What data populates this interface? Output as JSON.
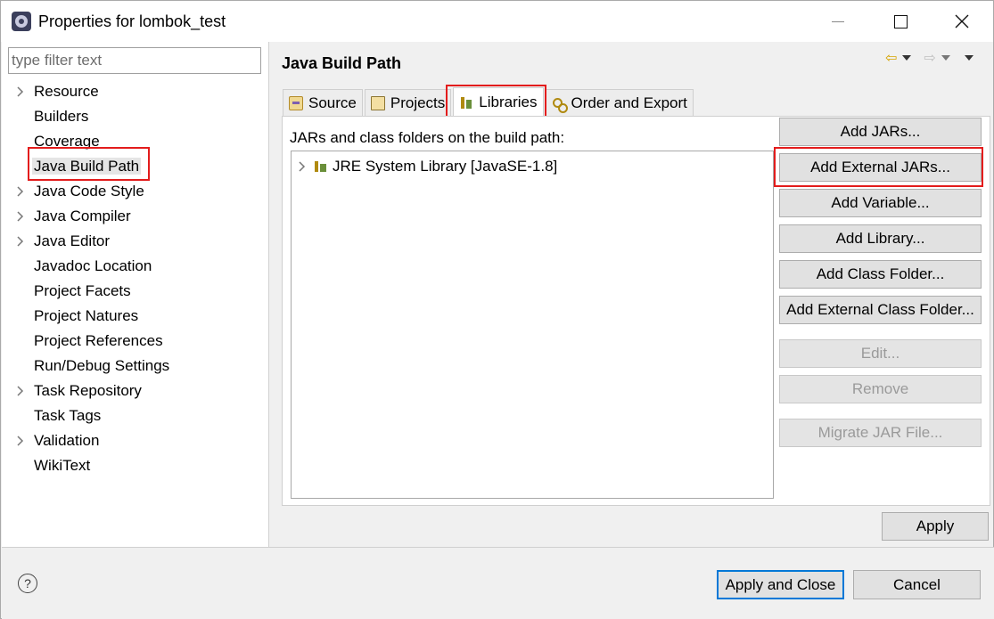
{
  "window": {
    "title": "Properties for lombok_test"
  },
  "filter": {
    "placeholder": "type filter text"
  },
  "tree": {
    "items": [
      {
        "label": "Resource",
        "expandable": true
      },
      {
        "label": "Builders",
        "expandable": false
      },
      {
        "label": "Coverage",
        "expandable": false
      },
      {
        "label": "Java Build Path",
        "expandable": false,
        "selected": true
      },
      {
        "label": "Java Code Style",
        "expandable": true
      },
      {
        "label": "Java Compiler",
        "expandable": true
      },
      {
        "label": "Java Editor",
        "expandable": true
      },
      {
        "label": "Javadoc Location",
        "expandable": false
      },
      {
        "label": "Project Facets",
        "expandable": false
      },
      {
        "label": "Project Natures",
        "expandable": false
      },
      {
        "label": "Project References",
        "expandable": false
      },
      {
        "label": "Run/Debug Settings",
        "expandable": false
      },
      {
        "label": "Task Repository",
        "expandable": true
      },
      {
        "label": "Task Tags",
        "expandable": false
      },
      {
        "label": "Validation",
        "expandable": true
      },
      {
        "label": "WikiText",
        "expandable": false
      }
    ]
  },
  "page": {
    "title": "Java Build Path",
    "tabs": [
      {
        "label": "Source",
        "icon": "source-folder-icon"
      },
      {
        "label": "Projects",
        "icon": "projects-folder-icon"
      },
      {
        "label": "Libraries",
        "icon": "libraries-icon",
        "active": true
      },
      {
        "label": "Order and Export",
        "icon": "order-export-icon"
      }
    ],
    "content_label": "JARs and class folders on the build path:",
    "libraries": [
      {
        "label": "JRE System Library [JavaSE-1.8]"
      }
    ],
    "buttons": {
      "add_jars": "Add JARs...",
      "add_external_jars": "Add External JARs...",
      "add_variable": "Add Variable...",
      "add_library": "Add Library...",
      "add_class_folder": "Add Class Folder...",
      "add_external_class_folder": "Add External Class Folder...",
      "edit": "Edit...",
      "remove": "Remove",
      "migrate_jar": "Migrate JAR File..."
    },
    "apply": "Apply"
  },
  "footer": {
    "help": "?",
    "apply_and_close": "Apply and Close",
    "cancel": "Cancel"
  },
  "colors": {
    "highlight": "#e31c1c",
    "primary_border": "#0078d7"
  }
}
